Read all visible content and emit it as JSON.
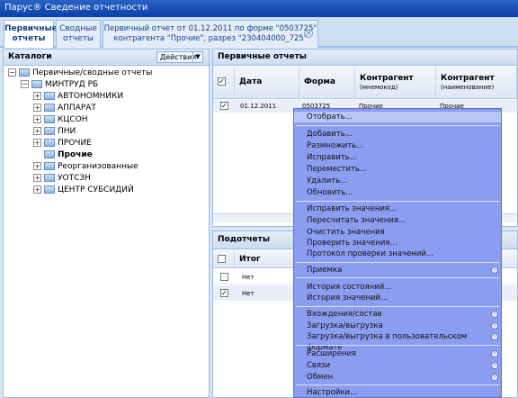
{
  "window": {
    "title": "Парус® Сведение отчетности"
  },
  "tabs": [
    {
      "label_l1": "Первичные",
      "label_l2": "отчеты"
    },
    {
      "label_l1": "Сводные",
      "label_l2": "отчеты"
    },
    {
      "label_l1": "Первичный отчет от 01.12.2011 по форме \"0503725\"",
      "label_l2": "контрагента \"Прочие\", разрез \"230404000_725\""
    }
  ],
  "catalogs": {
    "title": "Каталоги",
    "actions_label": "Действия",
    "tree": [
      {
        "label": "Первичные/сводные отчеты"
      },
      {
        "label": "МИНТРУД РБ"
      },
      {
        "label": "АВТОНОМНИКИ"
      },
      {
        "label": "АППАРАТ"
      },
      {
        "label": "КЦСОН"
      },
      {
        "label": "ПНИ"
      },
      {
        "label": "ПРОЧИЕ"
      },
      {
        "label": "Прочие"
      },
      {
        "label": "Реорганизованные"
      },
      {
        "label": "УОТСЗН"
      },
      {
        "label": "ЦЕНТР СУБСИДИЙ"
      }
    ]
  },
  "primary": {
    "title": "Первичные отчеты",
    "columns": {
      "date": "Дата",
      "form": "Форма",
      "contr_a": "Контрагент",
      "contr_a_sub": "(мнемокод)",
      "contr_b": "Контрагент",
      "contr_b_sub": "(наименование)"
    },
    "row": {
      "date": "01.12.2011",
      "form": "0503725",
      "contr_mnemo": "Прочие",
      "contr_name": "Прочие"
    }
  },
  "subreports": {
    "title": "Подотчеты",
    "column": "Итог",
    "rows": [
      {
        "value": "Нет"
      },
      {
        "value": "Нет"
      }
    ]
  },
  "context_menu": {
    "items": [
      {
        "label": "Отобрать..."
      },
      {
        "label": "Добавить..."
      },
      {
        "label": "Размножить..."
      },
      {
        "label": "Исправить..."
      },
      {
        "label": "Переместить..."
      },
      {
        "label": "Удалить..."
      },
      {
        "label": "Обновить..."
      },
      {
        "label": "Исправить значения..."
      },
      {
        "label": "Пересчитать значения..."
      },
      {
        "label": "Очистить значения"
      },
      {
        "label": "Проверить значения..."
      },
      {
        "label": "Протокол проверки значений..."
      },
      {
        "label": "Приемка"
      },
      {
        "label": "История состояний..."
      },
      {
        "label": "История значений..."
      },
      {
        "label": "Вхождения/состав"
      },
      {
        "label": "Загрузка/выгрузка"
      },
      {
        "label": "Загрузка/выгрузка в пользовательском формате"
      },
      {
        "label": "Расширения"
      },
      {
        "label": "Связи"
      },
      {
        "label": "Обмен"
      },
      {
        "label": "Настройки..."
      }
    ]
  },
  "colors": {
    "accent": "#15428b",
    "menu_bg": "#8a9df0",
    "title_bg": "#0a3fa8"
  }
}
